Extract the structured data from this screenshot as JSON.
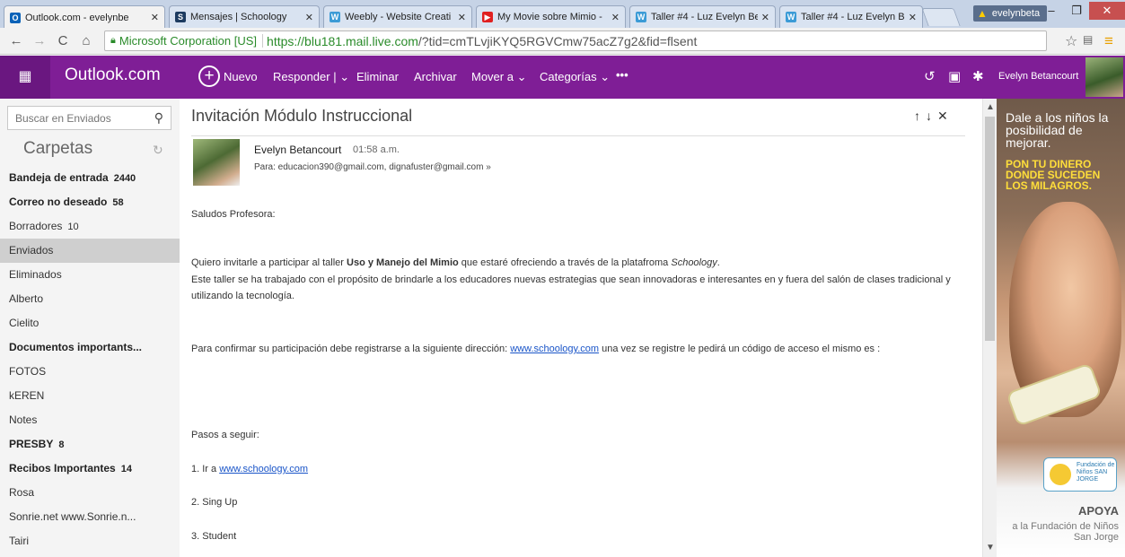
{
  "browser": {
    "tabs": [
      {
        "title": "Outlook.com - evelynbe",
        "favicon": "outlook-icon",
        "active": true
      },
      {
        "title": "Mensajes | Schoology",
        "favicon": "schoology-icon"
      },
      {
        "title": "Weebly - Website Creati",
        "favicon": "weebly-icon"
      },
      {
        "title": "My Movie sobre Mimio -",
        "favicon": "youtube-icon"
      },
      {
        "title": "Taller #4 - Luz Evelyn Be",
        "favicon": "weebly-icon"
      },
      {
        "title": "Taller #4 - Luz Evelyn Be",
        "favicon": "weebly-icon"
      }
    ],
    "profile_name": "evelynbeta",
    "org": "Microsoft Corporation [US]",
    "url_host": "https://blu181.mail.live.com",
    "url_rest": "/?tid=cmTLvjiKYQ5RGVCmw75acZ7g2&fid=flsent"
  },
  "app": {
    "brand": "Outlook.com",
    "commands": {
      "new": "Nuevo",
      "reply": "Responder",
      "delete": "Eliminar",
      "archive": "Archivar",
      "move": "Mover a",
      "categories": "Categorías",
      "more": "•••"
    },
    "user_name": "Evelyn Betancourt",
    "accent": "#7f1e96"
  },
  "sidebar": {
    "search_placeholder": "Buscar en Enviados",
    "folders_heading": "Carpetas",
    "folders": [
      {
        "label": "Bandeja de entrada",
        "count": "2440",
        "bold": true
      },
      {
        "label": "Correo no deseado",
        "count": "58",
        "bold": true
      },
      {
        "label": "Borradores",
        "count": "10",
        "bold": false
      },
      {
        "label": "Enviados",
        "count": "",
        "bold": false,
        "selected": true
      },
      {
        "label": "Eliminados",
        "count": "",
        "bold": false
      },
      {
        "label": "Alberto",
        "count": "",
        "bold": false
      },
      {
        "label": "Cielito",
        "count": "",
        "bold": false
      },
      {
        "label": "Documentos importantes",
        "display": "Documentos importants...",
        "count": "",
        "bold": true
      },
      {
        "label": "FOTOS",
        "count": "",
        "bold": false
      },
      {
        "label": "kEREN",
        "count": "",
        "bold": false
      },
      {
        "label": "Notes",
        "count": "",
        "bold": false
      },
      {
        "label": "PRESBY",
        "count": "8",
        "bold": true
      },
      {
        "label": "Recibos Importantes",
        "count": "14",
        "bold": true
      },
      {
        "label": "Rosa",
        "count": "",
        "bold": false
      },
      {
        "label": "Sonrie.net www.Sonrie.n...",
        "count": "",
        "bold": false
      },
      {
        "label": "Tairi",
        "count": "",
        "bold": false
      }
    ]
  },
  "message": {
    "subject": "Invitación Módulo Instruccional",
    "sender": "Evelyn Betancourt",
    "time": "01:58 a.m.",
    "to": "Para: educacion390@gmail.com, dignafuster@gmail.com",
    "greeting": "Saludos Profesora:",
    "p1_a": "Quiero invitarle a participar  al taller ",
    "p1_b": "Uso y Manejo del Mimio",
    "p1_c": " que estaré ofreciendo a través de la platafroma ",
    "p1_d": "Schoology",
    "p1_e": ".",
    "p2": "Este taller se ha trabajado con el propósito de brindarle a los educadores nuevas estrategias que sean innovadoras e interesantes en y fuera del salón de clases tradicional y utilizando la tecnología.",
    "p3_a": "Para confirmar su participación debe registrarse a la siguiente dirección: ",
    "p3_link": "www.schoology.com",
    "p3_b": " una vez se registre le pedirá un código de acceso el mismo es :",
    "steps_title": "Pasos a seguir:",
    "step1_a": "1. Ir a ",
    "step1_link": "www.schoology.com",
    "step2": "2. Sing Up",
    "step3": "3. Student"
  },
  "ad": {
    "line1": "Dale a los niños la posibilidad de mejorar.",
    "line2": "PON TU DINERO DONDE SUCEDEN LOS MILAGROS.",
    "logo_text": "Fundación de Niños SAN JORGE",
    "apoya": "APOYA",
    "line3": "a la Fundación de Niños San Jorge"
  }
}
